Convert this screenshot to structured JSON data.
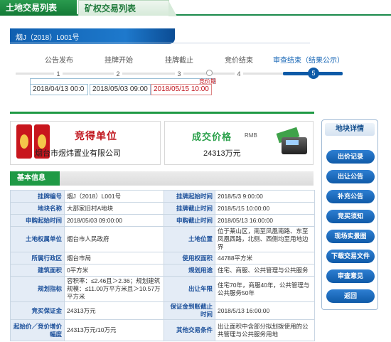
{
  "tabs": [
    {
      "label": "土地交易列表",
      "active": true
    },
    {
      "label": "矿权交易列表",
      "active": false
    }
  ],
  "title": "烟J（2018）L001号",
  "timeline": {
    "steps": [
      {
        "label": "公告发布",
        "num": "1"
      },
      {
        "label": "挂牌开始",
        "num": "2"
      },
      {
        "label": "挂牌截止",
        "num": "3"
      },
      {
        "label": "竞价结束",
        "num": "4"
      },
      {
        "label": "审查结束（结果公示）",
        "num": "5",
        "active": true
      }
    ],
    "dates": [
      "2018/04/13 00:0",
      "2018/05/03 09:00",
      "2018/05/15 10:00"
    ],
    "deadline_label": "竞价期"
  },
  "winner": {
    "title": "竞得单位",
    "name": "烟台市煜炜置业有限公司"
  },
  "deal": {
    "title": "成交价格",
    "unit": "RMB",
    "price": "24313万元"
  },
  "info_header": "基本信息",
  "rows": [
    [
      {
        "k": "挂牌编号",
        "v": "烟J（2018）L001号"
      },
      {
        "k": "挂牌起始时间",
        "v": "2018/5/3 9:00:00"
      }
    ],
    [
      {
        "k": "地块名称",
        "v": "大部家旧村A地块"
      },
      {
        "k": "挂牌截止时间",
        "v": "2018/5/15 10:00:00"
      }
    ],
    [
      {
        "k": "申购起始时间",
        "v": "2018/05/03 09:00:00"
      },
      {
        "k": "申购截止时间",
        "v": "2018/05/13 16:00:00"
      }
    ],
    [
      {
        "k": "土地权属单位",
        "v": "烟台市人民政府"
      },
      {
        "k": "土地位置",
        "v": "位于莱山区，南至凤凰南路、东至凤凰西路，北侧、西侧均至用地边界"
      }
    ],
    [
      {
        "k": "所属行政区",
        "v": "烟台市局"
      },
      {
        "k": "使用权面积",
        "v": "44788平方米"
      }
    ],
    [
      {
        "k": "建筑面积",
        "v": "0平方米"
      },
      {
        "k": "规划用途",
        "v": "住宅、商服、公共管理与公共服务"
      }
    ],
    [
      {
        "k": "规划指标",
        "v": "容积率：≤2.46且＞2.36；规划建筑规模：≤11.00万平方米且＞10.57万平方米"
      },
      {
        "k": "出让年限",
        "v": "住宅70年，商服40年，公共管理与公共服务50年"
      }
    ],
    [
      {
        "k": "竞买保证金",
        "v": "24313万元"
      },
      {
        "k": "保证金到账截止时间",
        "v": "2018/5/13 16:00:00"
      }
    ],
    [
      {
        "k": "起始价／竞价增价幅度",
        "v": "24313万元/10万元"
      },
      {
        "k": "其他交易条件",
        "v": "出让面积中含部分拟划拨使用的公共管理与公共服务用地"
      }
    ]
  ],
  "panel": {
    "title": "地块详情",
    "buttons": [
      "出价记录",
      "出让公告",
      "补充公告",
      "竞买须知",
      "现场实景图",
      "下载交易文件",
      "审查意见",
      "返回"
    ]
  }
}
